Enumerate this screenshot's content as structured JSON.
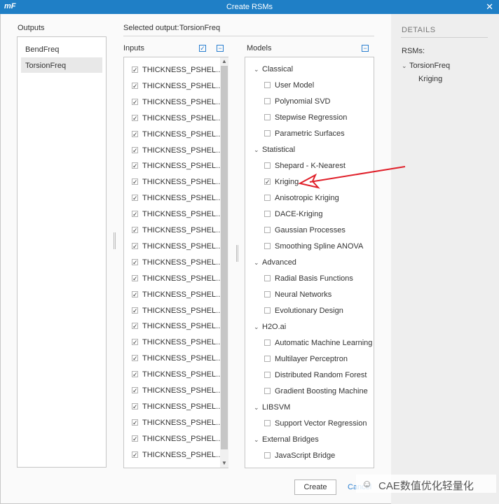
{
  "window": {
    "logo": "mF",
    "title": "Create RSMs",
    "close_glyph": "✕"
  },
  "outputs": {
    "header": "Outputs",
    "items": [
      {
        "label": "BendFreq",
        "selected": false
      },
      {
        "label": "TorsionFreq",
        "selected": true
      }
    ]
  },
  "selected_output": {
    "label": "Selected output:",
    "value": "TorsionFreq"
  },
  "inputs": {
    "header": "Inputs",
    "rows": [
      "THICKNESS_PSHEL...",
      "THICKNESS_PSHEL...",
      "THICKNESS_PSHEL...",
      "THICKNESS_PSHEL...",
      "THICKNESS_PSHEL...",
      "THICKNESS_PSHEL...",
      "THICKNESS_PSHEL...",
      "THICKNESS_PSHEL...",
      "THICKNESS_PSHEL...",
      "THICKNESS_PSHEL...",
      "THICKNESS_PSHEL...",
      "THICKNESS_PSHEL...",
      "THICKNESS_PSHEL...",
      "THICKNESS_PSHEL...",
      "THICKNESS_PSHEL...",
      "THICKNESS_PSHEL...",
      "THICKNESS_PSHEL...",
      "THICKNESS_PSHEL...",
      "THICKNESS_PSHEL...",
      "THICKNESS_PSHEL...",
      "THICKNESS_PSHEL...",
      "THICKNESS_PSHEL...",
      "THICKNESS_PSHEL...",
      "THICKNESS_PSHEL...",
      "THICKNESS_PSHEL..."
    ]
  },
  "models": {
    "header": "Models",
    "groups": [
      {
        "label": "Classical",
        "items": [
          {
            "label": "User Model",
            "checked": false
          },
          {
            "label": "Polynomial SVD",
            "checked": false
          },
          {
            "label": "Stepwise Regression",
            "checked": false
          },
          {
            "label": "Parametric Surfaces",
            "checked": false
          }
        ]
      },
      {
        "label": "Statistical",
        "items": [
          {
            "label": "Shepard - K-Nearest",
            "checked": false
          },
          {
            "label": "Kriging",
            "checked": true
          },
          {
            "label": "Anisotropic Kriging",
            "checked": false
          },
          {
            "label": "DACE-Kriging",
            "checked": false
          },
          {
            "label": "Gaussian Processes",
            "checked": false
          },
          {
            "label": "Smoothing Spline ANOVA",
            "checked": false
          }
        ]
      },
      {
        "label": "Advanced",
        "items": [
          {
            "label": "Radial Basis Functions",
            "checked": false
          },
          {
            "label": "Neural Networks",
            "checked": false
          },
          {
            "label": "Evolutionary Design",
            "checked": false
          }
        ]
      },
      {
        "label": "H2O.ai",
        "items": [
          {
            "label": "Automatic Machine Learning",
            "checked": false
          },
          {
            "label": "Multilayer Perceptron",
            "checked": false
          },
          {
            "label": "Distributed Random Forest",
            "checked": false
          },
          {
            "label": "Gradient Boosting Machine",
            "checked": false
          }
        ]
      },
      {
        "label": "LIBSVM",
        "items": [
          {
            "label": "Support Vector Regression",
            "checked": false
          }
        ]
      },
      {
        "label": "External Bridges",
        "items": [
          {
            "label": "JavaScript Bridge",
            "checked": false
          }
        ]
      }
    ]
  },
  "details": {
    "header": "DETAILS",
    "rsms_label": "RSMs:",
    "tree": {
      "parent": "TorsionFreq",
      "child": "Kriging"
    }
  },
  "buttons": {
    "create": "Create",
    "cancel": "Cancel"
  },
  "watermark": "CAE数值优化轻量化",
  "colors": {
    "titlebar": "#1f7fc6",
    "accent": "#2a7fd0",
    "arrow": "#e0202a"
  }
}
